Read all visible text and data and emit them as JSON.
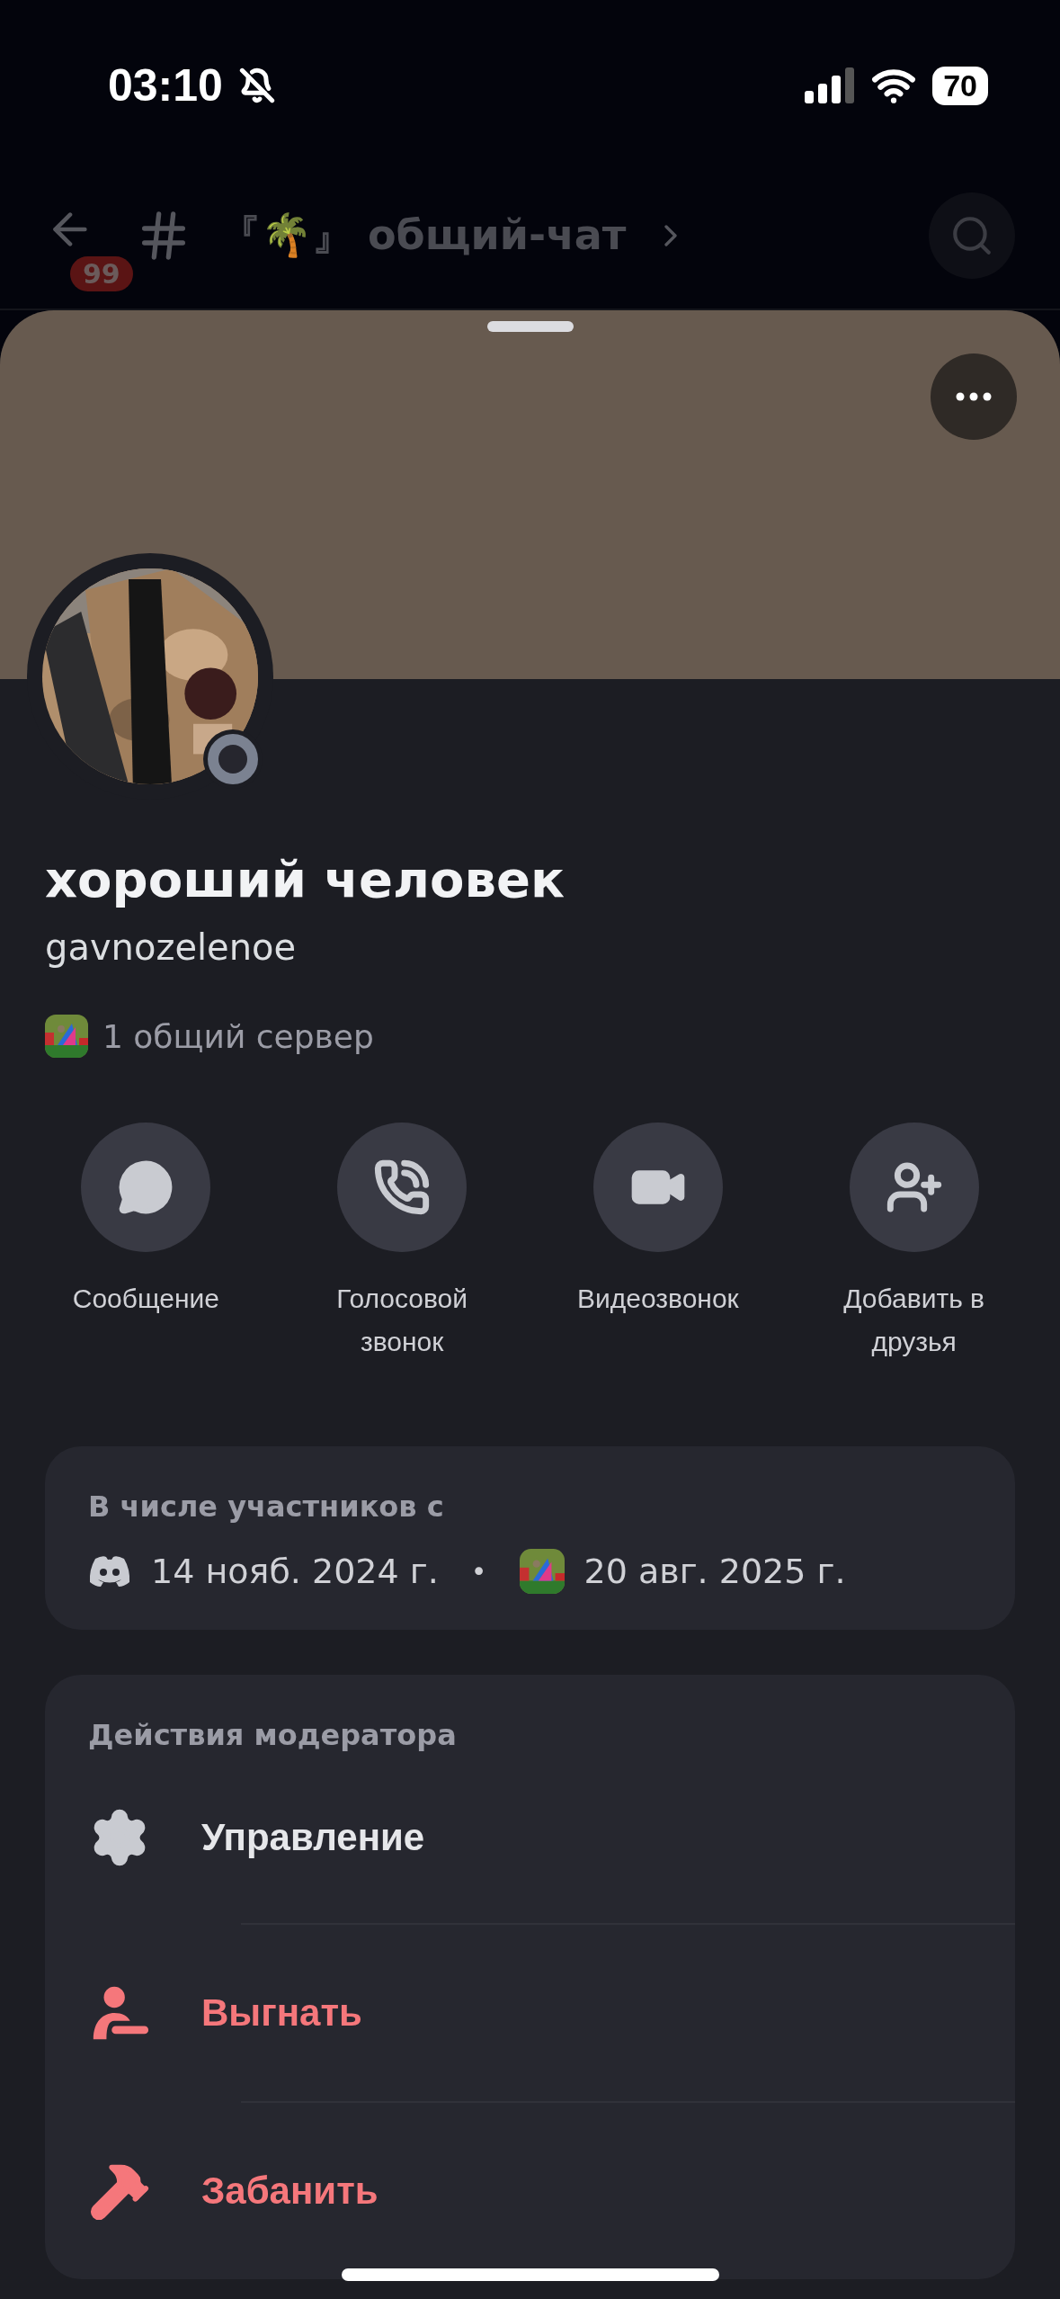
{
  "status_bar": {
    "time": "03:10",
    "battery": "70"
  },
  "header": {
    "unread_badge": "99",
    "channel": "『🌴』 общий-чат"
  },
  "profile": {
    "display_name": "хороший человек",
    "username": "gavnozelenoe",
    "mutual_servers": "1 общий сервер"
  },
  "actions": [
    {
      "kind": "message",
      "label": "Сообщение"
    },
    {
      "kind": "call",
      "label": "Голосовой звонок"
    },
    {
      "kind": "video",
      "label": "Видеозвонок"
    },
    {
      "kind": "friend",
      "label": "Добавить в друзья"
    }
  ],
  "member_since": {
    "title": "В числе участников с",
    "platform_date": "14 нояб. 2024 г.",
    "separator": "•",
    "server_date": "20 авг. 2025 г."
  },
  "moderator": {
    "title": "Действия модератора",
    "items": [
      {
        "kind": "manage",
        "label": "Управление",
        "danger": false
      },
      {
        "kind": "kick",
        "label": "Выгнать",
        "danger": true
      },
      {
        "kind": "ban",
        "label": "Забанить",
        "danger": true
      }
    ]
  }
}
